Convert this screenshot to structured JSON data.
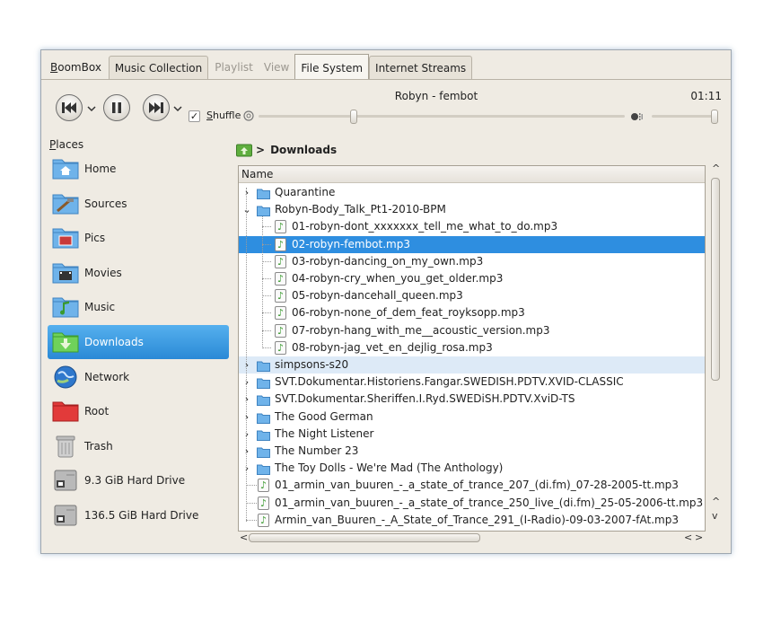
{
  "app": {
    "brand": "BoomBox"
  },
  "tabs": [
    {
      "label": "Music Collection",
      "state": "normal"
    },
    {
      "label": "Playlist",
      "state": "dim"
    },
    {
      "label": "View",
      "state": "dim"
    },
    {
      "label": "File System",
      "state": "active"
    },
    {
      "label": "Internet Streams",
      "state": "normal"
    }
  ],
  "player": {
    "track": "Robyn - fembot",
    "time": "01:11",
    "shuffle_label": "Shuffle",
    "shuffle_checked": true,
    "check_glyph": "✓",
    "seek_position": 0.26,
    "volume_level": 0.97
  },
  "places": {
    "title": "Places",
    "items": [
      {
        "label": "Home",
        "icon": "home-folder-icon"
      },
      {
        "label": "Sources",
        "icon": "sources-folder-icon"
      },
      {
        "label": "Pics",
        "icon": "pictures-folder-icon"
      },
      {
        "label": "Movies",
        "icon": "movies-folder-icon"
      },
      {
        "label": "Music",
        "icon": "music-folder-icon"
      },
      {
        "label": "Downloads",
        "icon": "downloads-folder-icon",
        "active": true
      },
      {
        "label": "Network",
        "icon": "network-globe-icon"
      },
      {
        "label": "Root",
        "icon": "root-folder-icon"
      },
      {
        "label": "Trash",
        "icon": "trash-icon"
      },
      {
        "label": "9.3 GiB Hard Drive",
        "icon": "hard-drive-icon"
      },
      {
        "label": "136.5 GiB Hard Drive",
        "icon": "hard-drive-icon"
      }
    ]
  },
  "breadcrumb": {
    "separator": ">",
    "current": "Downloads"
  },
  "tree": {
    "header": "Name",
    "rows": [
      {
        "name": "Quarantine",
        "type": "folder",
        "level": 0,
        "expander": "collapsed"
      },
      {
        "name": "Robyn-Body_Talk_Pt1-2010-BPM",
        "type": "folder",
        "level": 0,
        "expander": "expanded"
      },
      {
        "name": "01-robyn-dont_xxxxxxx_tell_me_what_to_do.mp3",
        "type": "audio",
        "level": 1
      },
      {
        "name": "02-robyn-fembot.mp3",
        "type": "audio",
        "level": 1,
        "selected": true
      },
      {
        "name": "03-robyn-dancing_on_my_own.mp3",
        "type": "audio",
        "level": 1
      },
      {
        "name": "04-robyn-cry_when_you_get_older.mp3",
        "type": "audio",
        "level": 1
      },
      {
        "name": "05-robyn-dancehall_queen.mp3",
        "type": "audio",
        "level": 1
      },
      {
        "name": "06-robyn-none_of_dem_feat_royksopp.mp3",
        "type": "audio",
        "level": 1
      },
      {
        "name": "07-robyn-hang_with_me__acoustic_version.mp3",
        "type": "audio",
        "level": 1
      },
      {
        "name": "08-robyn-jag_vet_en_dejlig_rosa.mp3",
        "type": "audio",
        "level": 1
      },
      {
        "name": "simpsons-s20",
        "type": "folder",
        "level": 0,
        "expander": "collapsed",
        "hover": true
      },
      {
        "name": "SVT.Dokumentar.Historiens.Fangar.SWEDISH.PDTV.XVID-CLASSIC",
        "type": "folder",
        "level": 0,
        "expander": "collapsed"
      },
      {
        "name": "SVT.Dokumentar.Sheriffen.I.Ryd.SWEDiSH.PDTV.XviD-TS",
        "type": "folder",
        "level": 0,
        "expander": "collapsed"
      },
      {
        "name": "The Good German",
        "type": "folder",
        "level": 0,
        "expander": "collapsed"
      },
      {
        "name": "The Night Listener",
        "type": "folder",
        "level": 0,
        "expander": "collapsed"
      },
      {
        "name": "The Number 23",
        "type": "folder",
        "level": 0,
        "expander": "collapsed"
      },
      {
        "name": "The Toy Dolls - We're Mad (The Anthology)",
        "type": "folder",
        "level": 0,
        "expander": "collapsed"
      },
      {
        "name": "01_armin_van_buuren_-_a_state_of_trance_207_(di.fm)_07-28-2005-tt.mp3",
        "type": "audio",
        "level": 0
      },
      {
        "name": "01_armin_van_buuren_-_a_state_of_trance_250_live_(di.fm)_25-05-2006-tt.mp3",
        "type": "audio",
        "level": 0
      },
      {
        "name": "Armin_van_Buuren_-_A_State_of_Trance_291_(I-Radio)-09-03-2007-fAt.mp3",
        "type": "audio",
        "level": 0
      }
    ]
  },
  "glyphs": {
    "expand_collapsed": "›",
    "expand_expanded": "⌄",
    "note": "♪",
    "scroll_up": "^",
    "scroll_down": "v",
    "scroll_left": "<",
    "scroll_right": ">"
  },
  "colors": {
    "selection": "#2e8ee0",
    "folder": "#6fb3ea",
    "window_bg": "#efebe3"
  }
}
